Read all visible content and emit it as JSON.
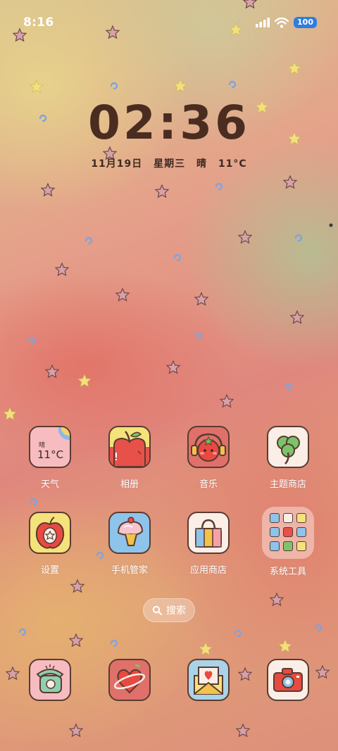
{
  "status_bar": {
    "time": "8:16",
    "battery": "100"
  },
  "lockscreen_widget": {
    "clock": "02:36",
    "date": "11月19日",
    "weekday": "星期三",
    "weather": "晴",
    "temperature": "11°C"
  },
  "weather_icon": {
    "condition": "晴",
    "temperature": "11°C"
  },
  "apps_row1": [
    {
      "label": "天气",
      "icon": "weather-icon"
    },
    {
      "label": "相册",
      "icon": "apple-photo-icon"
    },
    {
      "label": "音乐",
      "icon": "tomato-headphones-icon"
    },
    {
      "label": "主题商店",
      "icon": "clover-icon"
    }
  ],
  "apps_row2": [
    {
      "label": "设置",
      "icon": "apple-settings-icon"
    },
    {
      "label": "手机管家",
      "icon": "cupcake-icon"
    },
    {
      "label": "应用商店",
      "icon": "bag-icon"
    },
    {
      "label": "系统工具",
      "icon": "folder-icon"
    }
  ],
  "search": {
    "label": "搜索"
  },
  "dock": [
    {
      "icon": "phone-icon"
    },
    {
      "icon": "messages-icon"
    },
    {
      "icon": "mail-icon"
    },
    {
      "icon": "camera-icon"
    }
  ],
  "colors": {
    "accent_blue": "#2f7de0",
    "outline": "#5a3b32",
    "clock_text": "#4a2d20"
  }
}
